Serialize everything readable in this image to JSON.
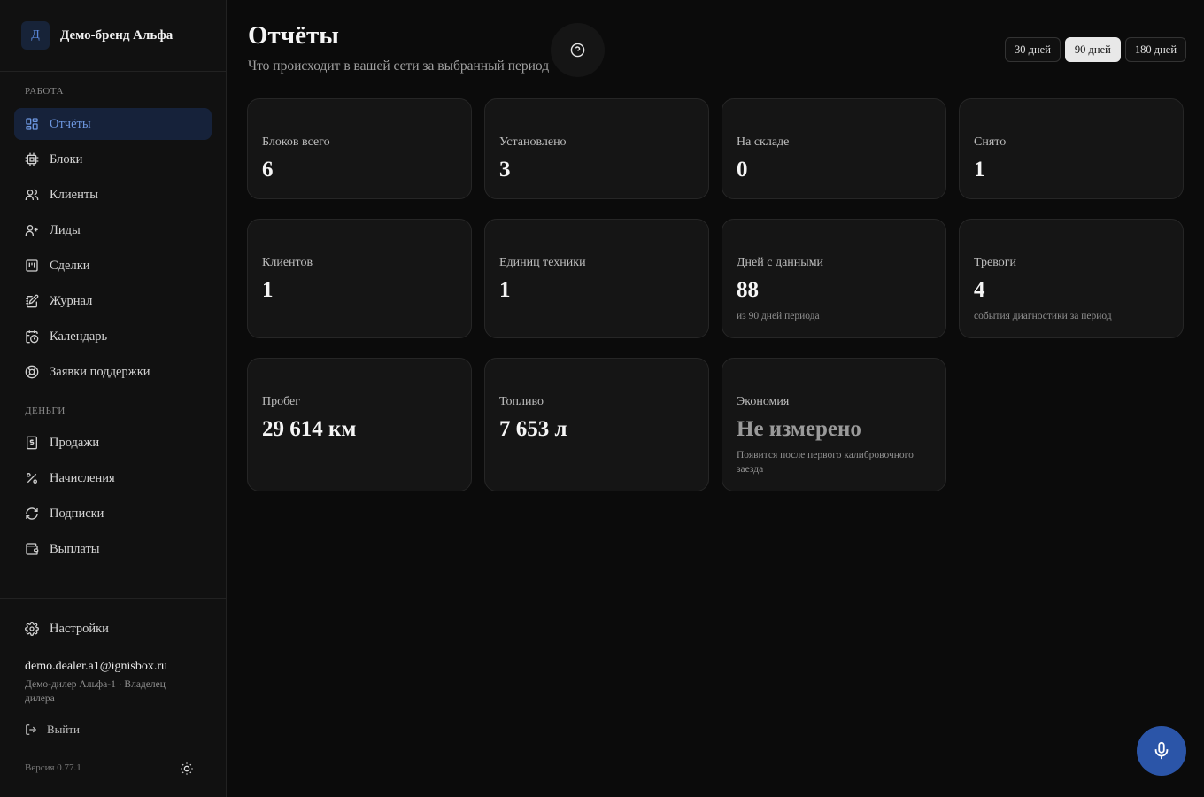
{
  "brand": {
    "logo_letter": "Д",
    "name": "Демо-бренд Альфа"
  },
  "sidebar": {
    "section_work": "РАБОТА",
    "section_money": "ДЕНЬГИ",
    "work_items": [
      {
        "label": "Отчёты",
        "icon": "dashboard-icon",
        "active": true
      },
      {
        "label": "Блоки",
        "icon": "chip-icon"
      },
      {
        "label": "Клиенты",
        "icon": "users-icon"
      },
      {
        "label": "Лиды",
        "icon": "user-plus-icon"
      },
      {
        "label": "Сделки",
        "icon": "kanban-icon"
      },
      {
        "label": "Журнал",
        "icon": "notebook-pen-icon"
      },
      {
        "label": "Календарь",
        "icon": "calendar-clock-icon"
      },
      {
        "label": "Заявки поддержки",
        "icon": "lifebuoy-icon"
      }
    ],
    "money_items": [
      {
        "label": "Продажи",
        "icon": "dollar-receipt-icon"
      },
      {
        "label": "Начисления",
        "icon": "percent-icon"
      },
      {
        "label": "Подписки",
        "icon": "refresh-icon"
      },
      {
        "label": "Выплаты",
        "icon": "wallet-icon"
      }
    ],
    "settings_label": "Настройки",
    "user": {
      "email": "demo.dealer.a1@ignisbox.ru",
      "role": "Демо-дилер Альфа-1 · Владелец дилера"
    },
    "logout_label": "Выйти",
    "version": "Версия 0.77.1"
  },
  "header": {
    "title": "Отчёты",
    "subtitle": "Что происходит в вашей сети за выбранный период",
    "periods": [
      {
        "label": "30 дней",
        "active": false
      },
      {
        "label": "90 дней",
        "active": true
      },
      {
        "label": "180 дней",
        "active": false
      }
    ]
  },
  "stats": {
    "blocks_total": {
      "label": "Блоков всего",
      "value": "6"
    },
    "installed": {
      "label": "Установлено",
      "value": "3"
    },
    "in_stock": {
      "label": "На складе",
      "value": "0"
    },
    "removed": {
      "label": "Снято",
      "value": "1"
    },
    "clients": {
      "label": "Клиентов",
      "value": "1"
    },
    "vehicles": {
      "label": "Единиц техники",
      "value": "1"
    },
    "days_with_data": {
      "label": "Дней с данными",
      "value": "88",
      "note": "из 90 дней периода"
    },
    "alarms": {
      "label": "Тревоги",
      "value": "4",
      "note": "события диагностики за период"
    },
    "mileage": {
      "label": "Пробег",
      "value": "29 614 км"
    },
    "fuel": {
      "label": "Топливо",
      "value": "7 653 л"
    },
    "savings": {
      "label": "Экономия",
      "value": "Не измерено",
      "note": "Появится после первого калибровочного заезда"
    }
  },
  "colors": {
    "accent": "#2b55a8",
    "active_nav_bg": "#16223a",
    "active_nav_text": "#6d97e0"
  }
}
